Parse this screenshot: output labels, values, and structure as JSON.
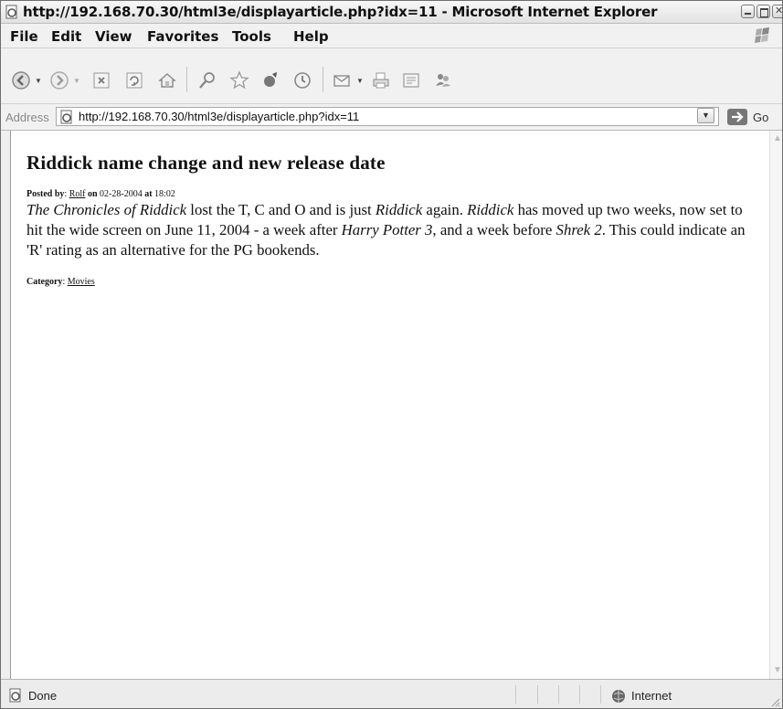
{
  "window": {
    "title": "http://192.168.70.30/html3e/displayarticle.php?idx=11 - Microsoft Internet Explorer"
  },
  "menubar": {
    "items": [
      "File",
      "Edit",
      "View",
      "Favorites",
      "Tools",
      "Help"
    ]
  },
  "toolbar": {
    "buttons": [
      "back-icon",
      "forward-icon",
      "stop-icon",
      "refresh-icon",
      "home-icon",
      "search-icon",
      "favorites-icon",
      "media-icon",
      "history-icon",
      "mail-icon",
      "print-icon",
      "edit-icon",
      "messenger-icon"
    ]
  },
  "addressbar": {
    "label": "Address",
    "url": "http://192.168.70.30/html3e/displayarticle.php?idx=11",
    "go_label": "Go"
  },
  "article": {
    "title": "Riddick name change and new release date",
    "posted_by_label": "Posted by",
    "author": "Rolf",
    "on_label": "on",
    "date": "02-28-2004",
    "at_label": "at",
    "time": "18:02",
    "body": {
      "t1": "The Chronicles of Riddick",
      "t2": " lost the T, C and O and is just ",
      "t3": "Riddick",
      "t4": " again. ",
      "t5": "Riddick",
      "t6": " has moved up two weeks, now set to hit the wide screen on June 11, 2004 - a week after ",
      "t7": "Harry Potter 3",
      "t8": ", and a week before ",
      "t9": "Shrek 2",
      "t10": ". This could indicate an 'R' rating as an alternative for the PG bookends."
    },
    "category_label": "Category",
    "category": "Movies"
  },
  "statusbar": {
    "text": "Done",
    "zone": "Internet"
  }
}
